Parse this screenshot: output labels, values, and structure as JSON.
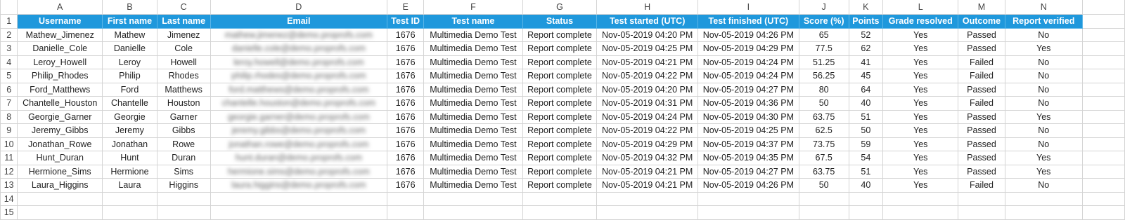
{
  "columns": [
    "A",
    "B",
    "C",
    "D",
    "E",
    "F",
    "G",
    "H",
    "I",
    "J",
    "K",
    "L",
    "M",
    "N"
  ],
  "headers": [
    "Username",
    "First name",
    "Last name",
    "Email",
    "Test ID",
    "Test name",
    "Status",
    "Test started (UTC)",
    "Test finished (UTC)",
    "Score (%)",
    "Points",
    "Grade resolved",
    "Outcome",
    "Report verified"
  ],
  "rows": [
    [
      "Mathew_Jimenez",
      "Mathew",
      "Jimenez",
      "mathew.jimenez@demo.proprofs.com",
      "1676",
      "Multimedia Demo Test",
      "Report complete",
      "Nov-05-2019 04:20 PM",
      "Nov-05-2019 04:26 PM",
      "65",
      "52",
      "Yes",
      "Passed",
      "No"
    ],
    [
      "Danielle_Cole",
      "Danielle",
      "Cole",
      "danielle.cole@demo.proprofs.com",
      "1676",
      "Multimedia Demo Test",
      "Report complete",
      "Nov-05-2019 04:25 PM",
      "Nov-05-2019 04:29 PM",
      "77.5",
      "62",
      "Yes",
      "Passed",
      "Yes"
    ],
    [
      "Leroy_Howell",
      "Leroy",
      "Howell",
      "leroy.howell@demo.proprofs.com",
      "1676",
      "Multimedia Demo Test",
      "Report complete",
      "Nov-05-2019 04:21 PM",
      "Nov-05-2019 04:24 PM",
      "51.25",
      "41",
      "Yes",
      "Failed",
      "No"
    ],
    [
      "Philip_Rhodes",
      "Philip",
      "Rhodes",
      "philip.rhodes@demo.proprofs.com",
      "1676",
      "Multimedia Demo Test",
      "Report complete",
      "Nov-05-2019 04:22 PM",
      "Nov-05-2019 04:24 PM",
      "56.25",
      "45",
      "Yes",
      "Failed",
      "No"
    ],
    [
      "Ford_Matthews",
      "Ford",
      "Matthews",
      "ford.matthews@demo.proprofs.com",
      "1676",
      "Multimedia Demo Test",
      "Report complete",
      "Nov-05-2019 04:20 PM",
      "Nov-05-2019 04:27 PM",
      "80",
      "64",
      "Yes",
      "Passed",
      "No"
    ],
    [
      "Chantelle_Houston",
      "Chantelle",
      "Houston",
      "chantelle.houston@demo.proprofs.com",
      "1676",
      "Multimedia Demo Test",
      "Report complete",
      "Nov-05-2019 04:31 PM",
      "Nov-05-2019 04:36 PM",
      "50",
      "40",
      "Yes",
      "Failed",
      "No"
    ],
    [
      "Georgie_Garner",
      "Georgie",
      "Garner",
      "georgie.garner@demo.proprofs.com",
      "1676",
      "Multimedia Demo Test",
      "Report complete",
      "Nov-05-2019 04:24 PM",
      "Nov-05-2019 04:30 PM",
      "63.75",
      "51",
      "Yes",
      "Passed",
      "Yes"
    ],
    [
      "Jeremy_Gibbs",
      "Jeremy",
      "Gibbs",
      "jeremy.gibbs@demo.proprofs.com",
      "1676",
      "Multimedia Demo Test",
      "Report complete",
      "Nov-05-2019 04:22 PM",
      "Nov-05-2019 04:25 PM",
      "62.5",
      "50",
      "Yes",
      "Passed",
      "No"
    ],
    [
      "Jonathan_Rowe",
      "Jonathan",
      "Rowe",
      "jonathan.rowe@demo.proprofs.com",
      "1676",
      "Multimedia Demo Test",
      "Report complete",
      "Nov-05-2019 04:29 PM",
      "Nov-05-2019 04:37 PM",
      "73.75",
      "59",
      "Yes",
      "Passed",
      "No"
    ],
    [
      "Hunt_Duran",
      "Hunt",
      "Duran",
      "hunt.duran@demo.proprofs.com",
      "1676",
      "Multimedia Demo Test",
      "Report complete",
      "Nov-05-2019 04:32 PM",
      "Nov-05-2019 04:35 PM",
      "67.5",
      "54",
      "Yes",
      "Passed",
      "Yes"
    ],
    [
      "Hermione_Sims",
      "Hermione",
      "Sims",
      "hermione.sims@demo.proprofs.com",
      "1676",
      "Multimedia Demo Test",
      "Report complete",
      "Nov-05-2019 04:21 PM",
      "Nov-05-2019 04:27 PM",
      "63.75",
      "51",
      "Yes",
      "Passed",
      "Yes"
    ],
    [
      "Laura_Higgins",
      "Laura",
      "Higgins",
      "laura.higgins@demo.proprofs.com",
      "1676",
      "Multimedia Demo Test",
      "Report complete",
      "Nov-05-2019 04:21 PM",
      "Nov-05-2019 04:26 PM",
      "50",
      "40",
      "Yes",
      "Failed",
      "No"
    ]
  ],
  "row_numbers": [
    "1",
    "2",
    "3",
    "4",
    "5",
    "6",
    "7",
    "8",
    "9",
    "10",
    "11",
    "12",
    "13",
    "14",
    "15"
  ],
  "colors": {
    "header_fill": "#1f98dc",
    "header_text": "#ffffff",
    "gridline": "#d4d4d4"
  }
}
